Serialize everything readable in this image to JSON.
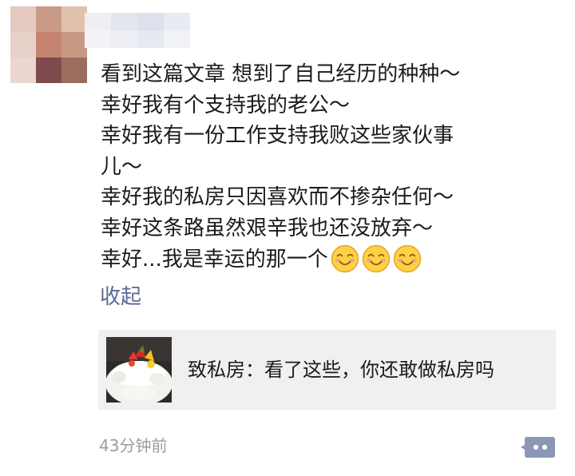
{
  "post": {
    "lines": [
      "看到这篇文章 想到了自己经历的种种～",
      "幸好我有个支持我的老公～",
      "幸好我有一份工作支持我败这些家伙事",
      "儿～",
      "幸好我的私房只因喜欢而不掺杂任何～",
      "幸好这条路虽然艰辛我也还没放弃～",
      "幸好...我是幸运的那一个"
    ],
    "emoji": [
      "smiling-face-icon",
      "smiling-face-icon",
      "smiling-face-icon"
    ],
    "collapse_label": "收起"
  },
  "share_card": {
    "title": "致私房：看了这些，你还敢做私房吗",
    "thumbnail": "cake-photo"
  },
  "footer": {
    "timestamp": "43分钟前",
    "comment_icon": "comment-dots-icon"
  },
  "colors": {
    "link": "#5b6a93",
    "card_bg": "#f0f0f0",
    "timestamp": "#9b9b9b",
    "comment_button": "#8c97b5"
  }
}
